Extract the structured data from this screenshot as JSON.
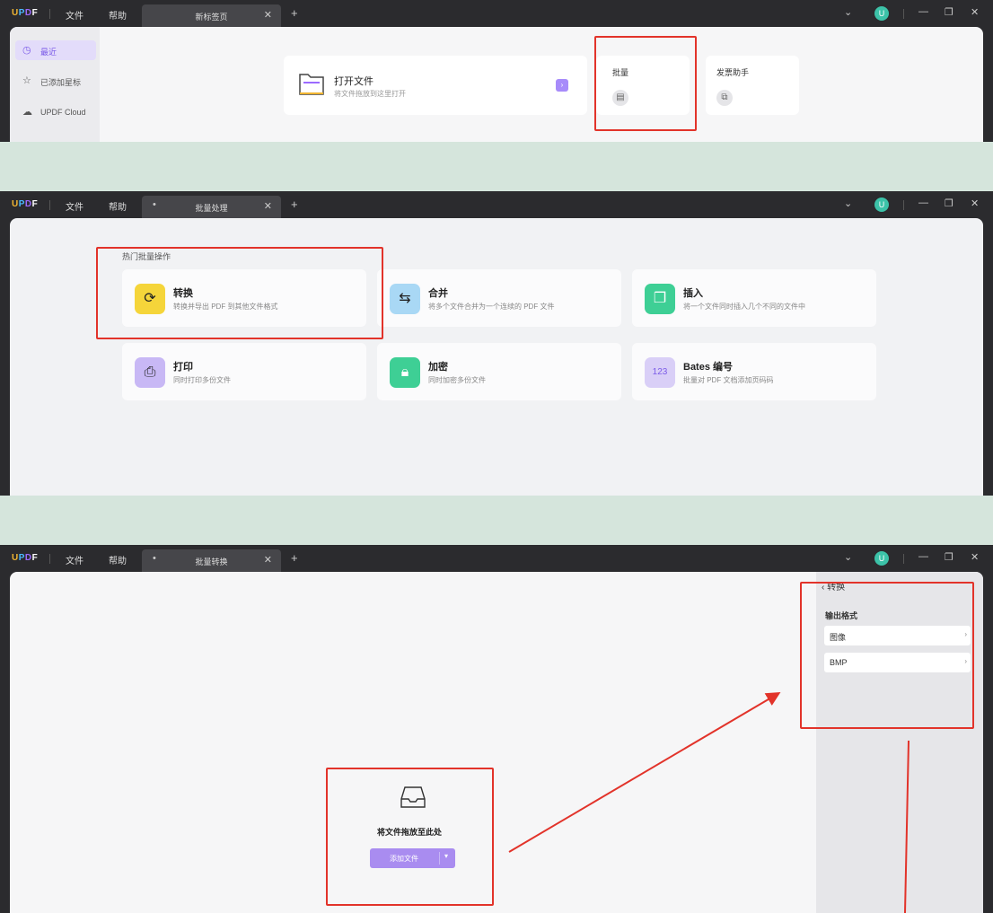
{
  "colors": {
    "accent": "#9d7bf0",
    "highlight_red": "#e2332a",
    "bg_strip": "#d5e5dc"
  },
  "app": {
    "logo": "UPDF",
    "menu_file": "文件",
    "menu_help": "帮助"
  },
  "window_icons": {
    "dropdown": "chevron-down-icon",
    "minimize": "minimize-icon",
    "restore": "restore-icon",
    "close": "close-icon"
  },
  "screen1": {
    "tab_title": "新标签页",
    "sidebar": [
      {
        "label": "最近",
        "icon": "clock-icon",
        "active": true
      },
      {
        "label": "已添加星标",
        "icon": "star-icon",
        "active": false
      },
      {
        "label": "UPDF Cloud",
        "icon": "cloud-icon",
        "active": false
      }
    ],
    "open_file": {
      "title": "打开文件",
      "desc": "将文件拖放到这里打开"
    },
    "batch": {
      "label": "批量"
    },
    "assistant": {
      "label": "发票助手"
    }
  },
  "screen2": {
    "tab_title": "批量处理",
    "section_title": "热门批量操作",
    "ops": [
      {
        "title": "转换",
        "desc": "转换并导出 PDF 到其他文件格式",
        "icon": "convert-icon",
        "color": "#f5d53a"
      },
      {
        "title": "合并",
        "desc": "将多个文件合并为一个连续的 PDF 文件",
        "icon": "merge-icon",
        "color": "#a9d8f5"
      },
      {
        "title": "插入",
        "desc": "将一个文件同时插入几个不同的文件中",
        "icon": "insert-icon",
        "color": "#3ecf95"
      },
      {
        "title": "打印",
        "desc": "同时打印多份文件",
        "icon": "print-icon",
        "color": "#c8b8f5"
      },
      {
        "title": "加密",
        "desc": "同时加密多份文件",
        "icon": "lock-icon",
        "color": "#3ecf95"
      },
      {
        "title": "Bates 编号",
        "desc": "批量对 PDF 文档添加页码码",
        "icon": "bates-icon",
        "color": "#d9cff7"
      }
    ]
  },
  "screen3": {
    "tab_title": "批量转换",
    "drop_text": "将文件拖放至此处",
    "add_button": "添加文件",
    "panel": {
      "back_label": "转换",
      "output_label": "输出格式",
      "format_value": "图像",
      "subformat_value": "BMP"
    }
  }
}
